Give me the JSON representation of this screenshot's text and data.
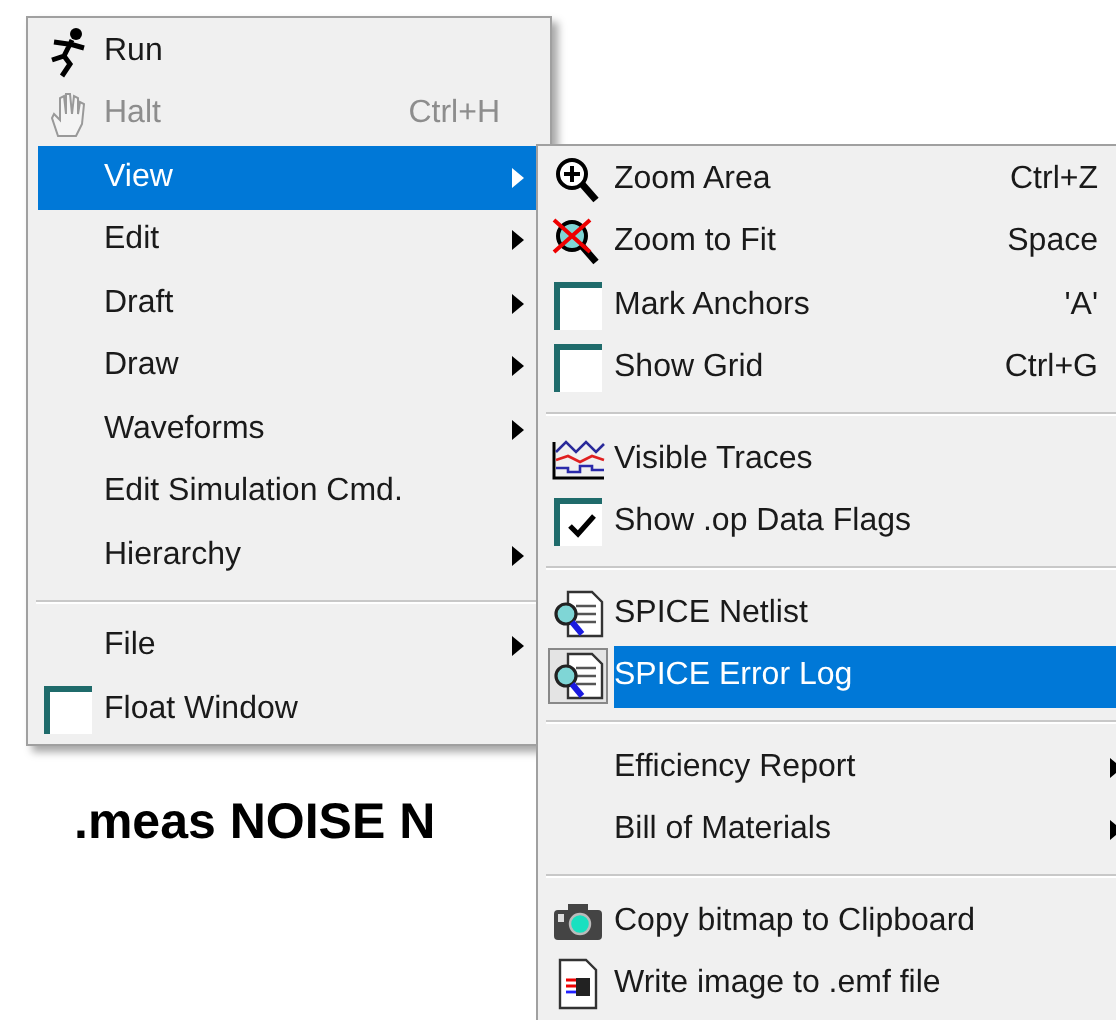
{
  "background_text": ".meas NOISE N",
  "menu": [
    {
      "kind": "item",
      "label": "Run",
      "disabled": false,
      "selected": false,
      "submenu": false
    },
    {
      "kind": "item",
      "label": "Halt",
      "shortcut": "Ctrl+H",
      "disabled": true,
      "selected": false,
      "submenu": false
    },
    {
      "kind": "item",
      "label": "View",
      "disabled": false,
      "selected": true,
      "submenu": true
    },
    {
      "kind": "item",
      "label": "Edit",
      "disabled": false,
      "selected": false,
      "submenu": true
    },
    {
      "kind": "item",
      "label": "Draft",
      "disabled": false,
      "selected": false,
      "submenu": true
    },
    {
      "kind": "item",
      "label": "Draw",
      "disabled": false,
      "selected": false,
      "submenu": true
    },
    {
      "kind": "item",
      "label": "Waveforms",
      "disabled": false,
      "selected": false,
      "submenu": true
    },
    {
      "kind": "item",
      "label": "Edit Simulation Cmd.",
      "disabled": false,
      "selected": false,
      "submenu": false
    },
    {
      "kind": "item",
      "label": "Hierarchy",
      "disabled": false,
      "selected": false,
      "submenu": true
    },
    {
      "kind": "separator"
    },
    {
      "kind": "item",
      "label": "File",
      "disabled": false,
      "selected": false,
      "submenu": true
    },
    {
      "kind": "check",
      "label": "Float Window",
      "checked": false,
      "disabled": false,
      "selected": false
    }
  ],
  "submenu": [
    {
      "kind": "item",
      "label": "Zoom Area",
      "shortcut": "Ctrl+Z",
      "disabled": false,
      "selected": false,
      "submenu": false
    },
    {
      "kind": "item",
      "label": "Zoom to Fit",
      "shortcut": "Space",
      "disabled": false,
      "selected": false,
      "submenu": false
    },
    {
      "kind": "check",
      "label": "Mark Anchors",
      "shortcut": "'A'",
      "checked": false,
      "disabled": false,
      "selected": false
    },
    {
      "kind": "check",
      "label": "Show Grid",
      "shortcut": "Ctrl+G",
      "checked": false,
      "disabled": false,
      "selected": false
    },
    {
      "kind": "separator"
    },
    {
      "kind": "item",
      "label": "Visible Traces",
      "disabled": false,
      "selected": false,
      "submenu": false
    },
    {
      "kind": "check",
      "label": "Show .op Data Flags",
      "checked": true,
      "disabled": false,
      "selected": false
    },
    {
      "kind": "separator"
    },
    {
      "kind": "item",
      "label": "SPICE Netlist",
      "disabled": false,
      "selected": false,
      "submenu": false
    },
    {
      "kind": "item",
      "label": "SPICE Error Log",
      "disabled": false,
      "selected": true,
      "submenu": false
    },
    {
      "kind": "separator"
    },
    {
      "kind": "item",
      "label": "Efficiency Report",
      "disabled": false,
      "selected": false,
      "submenu": true
    },
    {
      "kind": "item",
      "label": "Bill of Materials",
      "disabled": false,
      "selected": false,
      "submenu": true
    },
    {
      "kind": "separator"
    },
    {
      "kind": "item",
      "label": "Copy bitmap to Clipboard",
      "disabled": false,
      "selected": false,
      "submenu": false
    },
    {
      "kind": "item",
      "label": "Write image to .emf file",
      "disabled": false,
      "selected": false,
      "submenu": false
    }
  ]
}
